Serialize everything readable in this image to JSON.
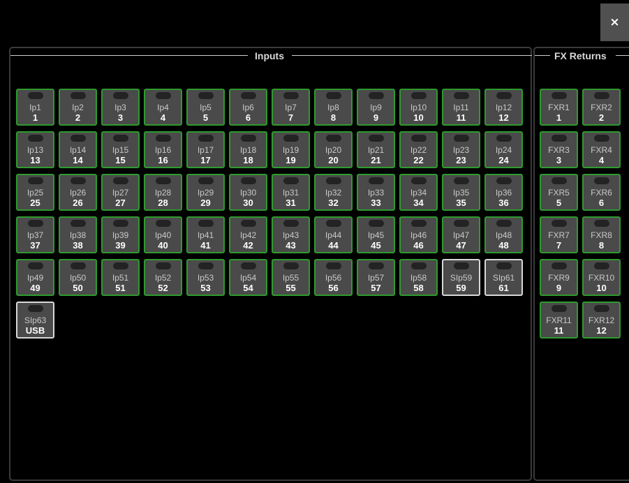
{
  "toolbar": {
    "close_label": "×"
  },
  "inputs_panel": {
    "title": "Inputs",
    "tiles": [
      {
        "name": "Ip1",
        "num": "1"
      },
      {
        "name": "Ip2",
        "num": "2"
      },
      {
        "name": "Ip3",
        "num": "3"
      },
      {
        "name": "Ip4",
        "num": "4"
      },
      {
        "name": "Ip5",
        "num": "5"
      },
      {
        "name": "Ip6",
        "num": "6"
      },
      {
        "name": "Ip7",
        "num": "7"
      },
      {
        "name": "Ip8",
        "num": "8"
      },
      {
        "name": "Ip9",
        "num": "9"
      },
      {
        "name": "Ip10",
        "num": "10"
      },
      {
        "name": "Ip11",
        "num": "11"
      },
      {
        "name": "Ip12",
        "num": "12"
      },
      {
        "name": "Ip13",
        "num": "13"
      },
      {
        "name": "Ip14",
        "num": "14"
      },
      {
        "name": "Ip15",
        "num": "15"
      },
      {
        "name": "Ip16",
        "num": "16"
      },
      {
        "name": "Ip17",
        "num": "17"
      },
      {
        "name": "Ip18",
        "num": "18"
      },
      {
        "name": "Ip19",
        "num": "19"
      },
      {
        "name": "Ip20",
        "num": "20"
      },
      {
        "name": "Ip21",
        "num": "21"
      },
      {
        "name": "Ip22",
        "num": "22"
      },
      {
        "name": "Ip23",
        "num": "23"
      },
      {
        "name": "Ip24",
        "num": "24"
      },
      {
        "name": "Ip25",
        "num": "25"
      },
      {
        "name": "Ip26",
        "num": "26"
      },
      {
        "name": "Ip27",
        "num": "27"
      },
      {
        "name": "Ip28",
        "num": "28"
      },
      {
        "name": "Ip29",
        "num": "29"
      },
      {
        "name": "Ip30",
        "num": "30"
      },
      {
        "name": "Ip31",
        "num": "31"
      },
      {
        "name": "Ip32",
        "num": "32"
      },
      {
        "name": "Ip33",
        "num": "33"
      },
      {
        "name": "Ip34",
        "num": "34"
      },
      {
        "name": "Ip35",
        "num": "35"
      },
      {
        "name": "Ip36",
        "num": "36"
      },
      {
        "name": "Ip37",
        "num": "37"
      },
      {
        "name": "Ip38",
        "num": "38"
      },
      {
        "name": "Ip39",
        "num": "39"
      },
      {
        "name": "Ip40",
        "num": "40"
      },
      {
        "name": "Ip41",
        "num": "41"
      },
      {
        "name": "Ip42",
        "num": "42"
      },
      {
        "name": "Ip43",
        "num": "43"
      },
      {
        "name": "Ip44",
        "num": "44"
      },
      {
        "name": "Ip45",
        "num": "45"
      },
      {
        "name": "Ip46",
        "num": "46"
      },
      {
        "name": "Ip47",
        "num": "47"
      },
      {
        "name": "Ip48",
        "num": "48"
      },
      {
        "name": "Ip49",
        "num": "49"
      },
      {
        "name": "Ip50",
        "num": "50"
      },
      {
        "name": "Ip51",
        "num": "51"
      },
      {
        "name": "Ip52",
        "num": "52"
      },
      {
        "name": "Ip53",
        "num": "53"
      },
      {
        "name": "Ip54",
        "num": "54"
      },
      {
        "name": "Ip55",
        "num": "55"
      },
      {
        "name": "Ip56",
        "num": "56"
      },
      {
        "name": "Ip57",
        "num": "57"
      },
      {
        "name": "Ip58",
        "num": "58"
      },
      {
        "name": "SIp59",
        "num": "59",
        "style": "white"
      },
      {
        "name": "SIp61",
        "num": "61",
        "style": "white"
      },
      {
        "name": "SIp63",
        "num": "USB",
        "style": "white"
      }
    ]
  },
  "fx_panel": {
    "title": "FX Returns",
    "tiles": [
      {
        "name": "FXR1",
        "num": "1"
      },
      {
        "name": "FXR2",
        "num": "2"
      },
      {
        "name": "FXR3",
        "num": "3"
      },
      {
        "name": "FXR4",
        "num": "4"
      },
      {
        "name": "FXR5",
        "num": "5"
      },
      {
        "name": "FXR6",
        "num": "6"
      },
      {
        "name": "FXR7",
        "num": "7"
      },
      {
        "name": "FXR8",
        "num": "8"
      },
      {
        "name": "FXR9",
        "num": "9"
      },
      {
        "name": "FXR10",
        "num": "10"
      },
      {
        "name": "FXR11",
        "num": "11"
      },
      {
        "name": "FXR12",
        "num": "12"
      }
    ]
  },
  "colors": {
    "active_border": "#2e9a2e",
    "stereo_border": "#d8d8d8",
    "tile_fill": "#4a4a4a"
  }
}
